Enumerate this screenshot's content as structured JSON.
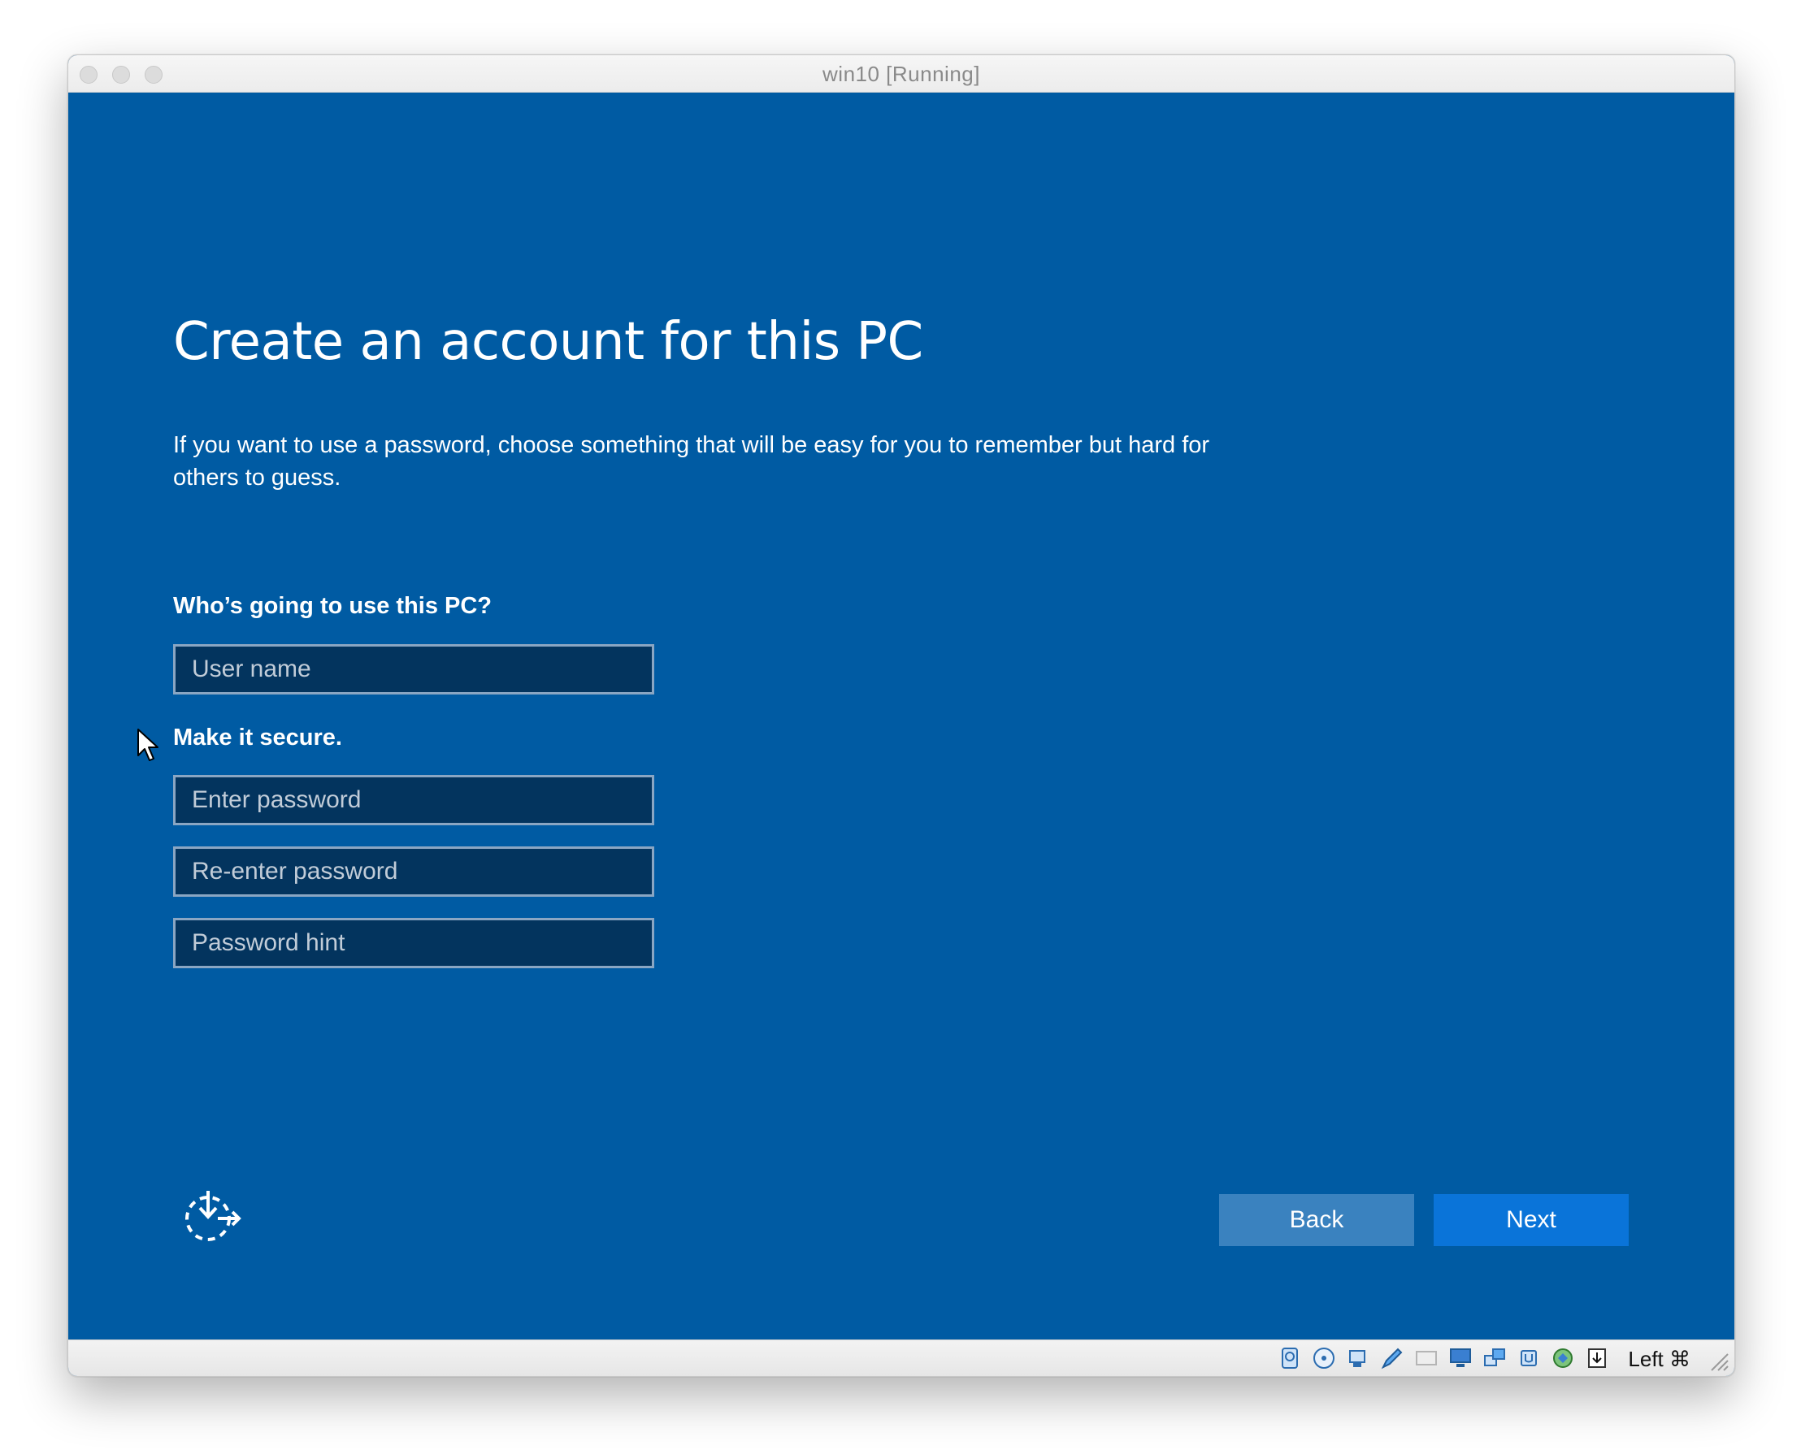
{
  "window": {
    "title": "win10 [Running]"
  },
  "setup": {
    "heading": "Create an account for this PC",
    "description": "If you want to use a password, choose something that will be easy for you to remember but hard for others to guess.",
    "user_section_label": "Who’s going to use this PC?",
    "username": {
      "value": "",
      "placeholder": "User name"
    },
    "secure_section_label": "Make it secure.",
    "password": {
      "value": "",
      "placeholder": "Enter password"
    },
    "password_confirm": {
      "value": "",
      "placeholder": "Re-enter password"
    },
    "password_hint": {
      "value": "",
      "placeholder": "Password hint"
    },
    "back_label": "Back",
    "next_label": "Next"
  },
  "statusbar": {
    "host_key_label": "Left ⌘",
    "icons": [
      "hard-disk-icon",
      "optical-drive-icon",
      "usb-icon",
      "shared-folders-icon",
      "display-icon",
      "screen-icon",
      "network-icon",
      "cpu-icon",
      "recording-icon",
      "download-arrow-icon"
    ]
  },
  "colors": {
    "background": "#005ba3",
    "input_background": "#03345e",
    "input_border": "#8aa6c3",
    "back_button": "#3a82bf",
    "next_button": "#0a74d9"
  }
}
